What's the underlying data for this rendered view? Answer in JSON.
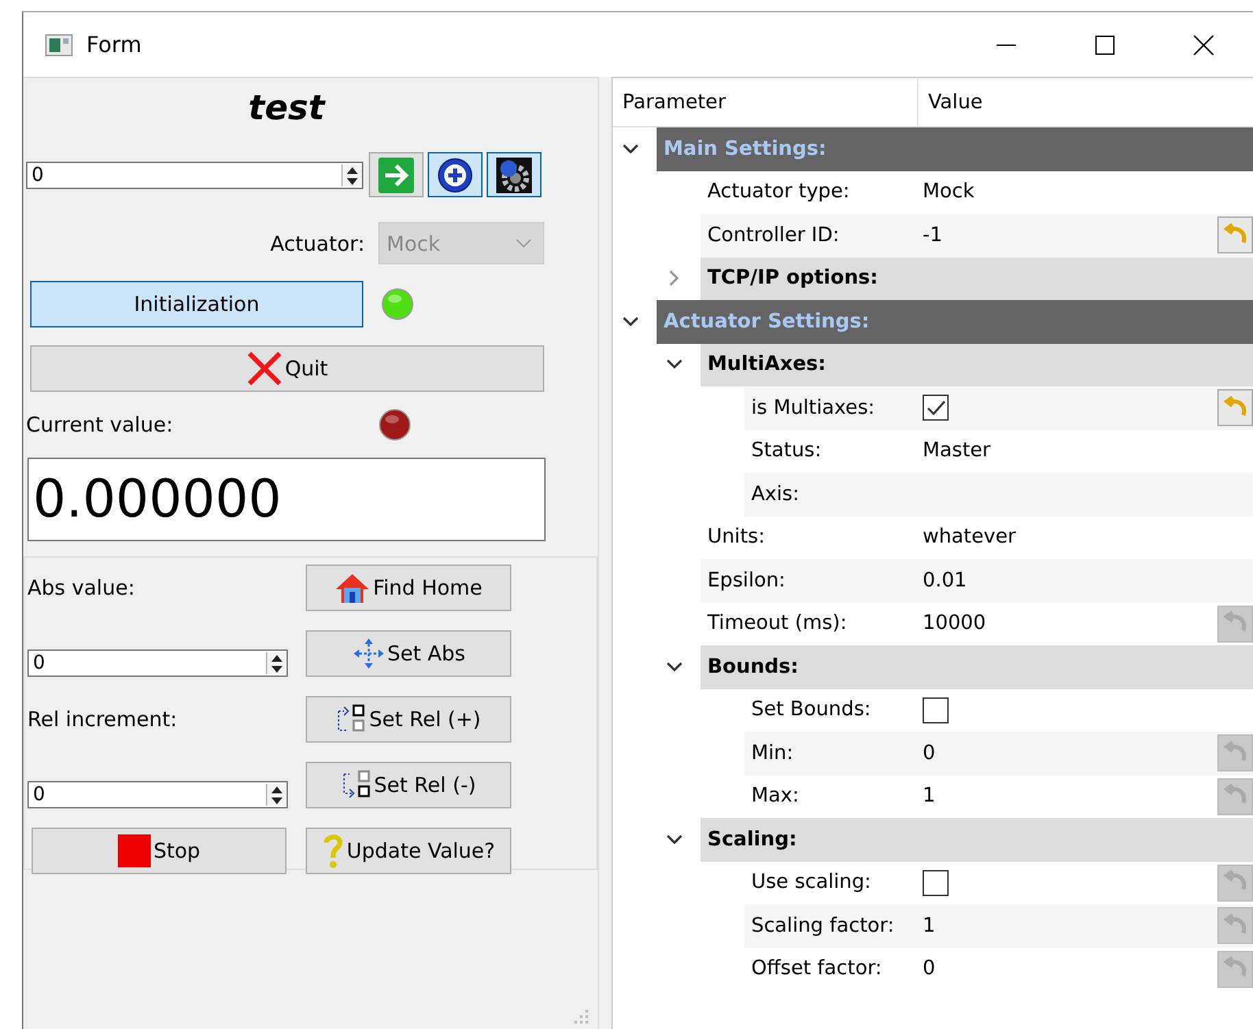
{
  "window": {
    "title": "Form"
  },
  "panel": {
    "title": "test",
    "spin_value": "0",
    "actuator_label": "Actuator:",
    "actuator_value": "Mock",
    "actuator_disabled": true,
    "init_button": "Initialization",
    "init_led": {
      "on": true
    },
    "quit_button": "Quit",
    "current_label": "Current value:",
    "current_led": {
      "on": false
    },
    "current_value": "0.000000",
    "abs_label": "Abs value:",
    "abs_input": "0",
    "rel_label": "Rel increment:",
    "rel_input": "0",
    "find_home_button": "Find Home",
    "set_abs_button": "Set Abs",
    "set_rel_plus_button": "Set Rel (+)",
    "set_rel_minus_button": "Set Rel (-)",
    "stop_button": "Stop",
    "update_button": "Update Value?"
  },
  "tree": {
    "columns": [
      "Parameter",
      "Value"
    ],
    "items": [
      {
        "kind": "group",
        "label": "Main Settings:",
        "expanded": true,
        "children": [
          {
            "kind": "param",
            "label": "Actuator type:",
            "value": "Mock"
          },
          {
            "kind": "param",
            "label": "Controller ID:",
            "value": "-1",
            "reset_enabled": true
          },
          {
            "kind": "subgroup",
            "label": "TCP/IP options:",
            "expanded": false
          }
        ]
      },
      {
        "kind": "group",
        "label": "Actuator Settings:",
        "expanded": true,
        "children": [
          {
            "kind": "subgroup",
            "label": "MultiAxes:",
            "expanded": true,
            "children": [
              {
                "kind": "checkbox",
                "label": "is Multiaxes:",
                "checked": true,
                "reset_enabled": true
              },
              {
                "kind": "param",
                "label": "Status:",
                "value": "Master"
              },
              {
                "kind": "param",
                "label": "Axis:"
              }
            ]
          },
          {
            "kind": "param",
            "label": "Units:",
            "value": "whatever"
          },
          {
            "kind": "param",
            "label": "Epsilon:",
            "value": "0.01"
          },
          {
            "kind": "param",
            "label": "Timeout (ms):",
            "value": "10000",
            "reset_enabled": false
          },
          {
            "kind": "subgroup",
            "label": "Bounds:",
            "expanded": true,
            "children": [
              {
                "kind": "checkbox",
                "label": "Set Bounds:",
                "checked": false
              },
              {
                "kind": "param",
                "label": "Min:",
                "value": "0",
                "reset_enabled": false
              },
              {
                "kind": "param",
                "label": "Max:",
                "value": "1",
                "reset_enabled": false
              }
            ]
          },
          {
            "kind": "subgroup",
            "label": "Scaling:",
            "expanded": true,
            "children": [
              {
                "kind": "checkbox",
                "label": "Use scaling:",
                "checked": false,
                "reset_enabled": false
              },
              {
                "kind": "param",
                "label": "Scaling factor:",
                "value": "1",
                "reset_enabled": false
              },
              {
                "kind": "param",
                "label": "Offset factor:",
                "value": "0",
                "reset_enabled": false
              }
            ]
          }
        ]
      }
    ]
  }
}
